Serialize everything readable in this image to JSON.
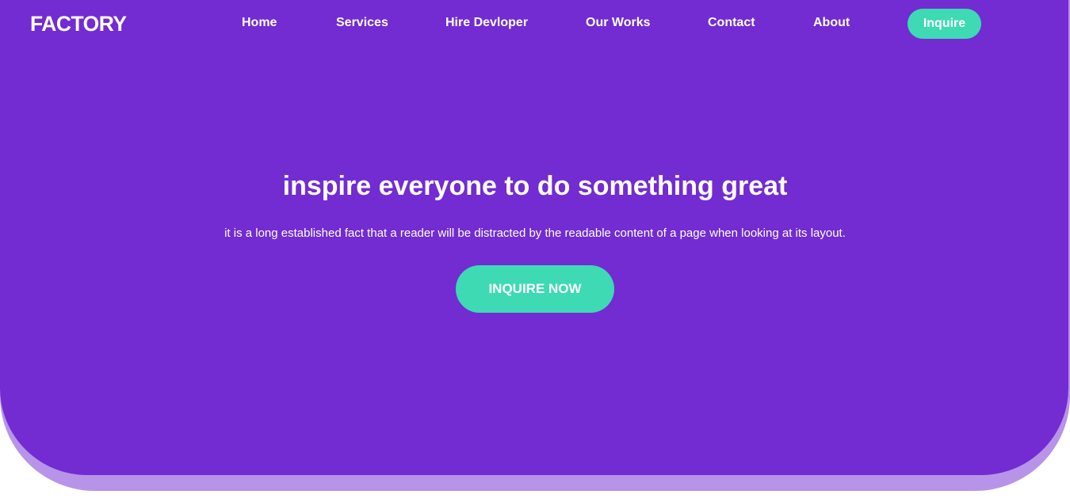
{
  "brand": {
    "logo_text": "FACTORY"
  },
  "nav": {
    "items": [
      {
        "label": "Home"
      },
      {
        "label": "Services"
      },
      {
        "label": "Hire Devloper"
      },
      {
        "label": "Our Works"
      },
      {
        "label": "Contact"
      },
      {
        "label": "About"
      }
    ],
    "inquire_label": "Inquire"
  },
  "hero": {
    "headline": "inspire everyone to do something great",
    "subtext": "it is a long established fact that a reader will be distracted by the readable content of a page when looking at its layout.",
    "cta_label": "INQUIRE NOW"
  },
  "colors": {
    "hero_background": "#722cd2",
    "hero_shadow": "#b794e8",
    "accent": "#3ddab4",
    "text": "#ffffff"
  }
}
